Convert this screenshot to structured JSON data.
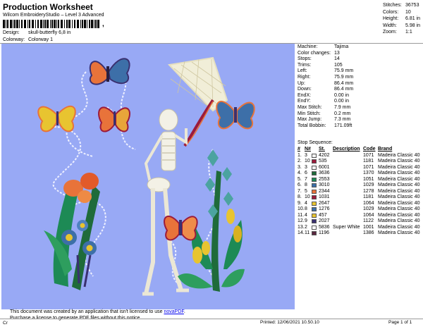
{
  "header": {
    "title": "Production Worksheet",
    "subtitle": "Wilcom EmbroideryStudio – Level 3 Advanced",
    "barcode_suffix": ",",
    "design_label": "Design:",
    "design_value": "skull-butterfly 6,8 in",
    "colorway_label": "Colorway:",
    "colorway_value": "Colorway 1"
  },
  "summary": [
    {
      "label": "Stitches:",
      "value": "36753"
    },
    {
      "label": "Colors:",
      "value": "10"
    },
    {
      "label": "Height:",
      "value": "6.81 in"
    },
    {
      "label": "Width:",
      "value": "5.98 in"
    },
    {
      "label": "Zoom:",
      "value": "1:1"
    }
  ],
  "specs": [
    {
      "label": "Machine:",
      "value": "Tajima"
    },
    {
      "label": "Color changes:",
      "value": "13"
    },
    {
      "label": "Stops:",
      "value": "14"
    },
    {
      "label": "Trims:",
      "value": "105"
    },
    {
      "label": "Left:",
      "value": "75.9 mm"
    },
    {
      "label": "Right:",
      "value": "75.9 mm"
    },
    {
      "label": "Up:",
      "value": "86.4 mm"
    },
    {
      "label": "Down:",
      "value": "86.4 mm"
    },
    {
      "label": "EndX:",
      "value": "0.00 in"
    },
    {
      "label": "EndY:",
      "value": "0.00 in"
    },
    {
      "label": "Max Stitch:",
      "value": "7.9 mm"
    },
    {
      "label": "Min Stitch:",
      "value": "0.2 mm"
    },
    {
      "label": "Max Jump:",
      "value": "7.3 mm"
    },
    {
      "label": "Total Bobbin:",
      "value": "171.09ft"
    }
  ],
  "stop_sequence": {
    "heading": "Stop Sequence:",
    "columns": [
      "#",
      "N#",
      "St.",
      "Description",
      "Code",
      "Brand"
    ],
    "rows": [
      {
        "idx": "1.",
        "n": "3",
        "color": "#f2f2f2",
        "st": "4202",
        "desc": "",
        "code": "1071",
        "brand": "Madeira Classic 40"
      },
      {
        "idx": "2.",
        "n": "10",
        "color": "#9b1b3c",
        "st": "535",
        "desc": "",
        "code": "1181",
        "brand": "Madeira Classic 40"
      },
      {
        "idx": "3.",
        "n": "3",
        "color": "#f2f2f2",
        "st": "6001",
        "desc": "",
        "code": "1071",
        "brand": "Madeira Classic 40"
      },
      {
        "idx": "4.",
        "n": "6",
        "color": "#1f6b3a",
        "st": "3636",
        "desc": "",
        "code": "1370",
        "brand": "Madeira Classic 40"
      },
      {
        "idx": "5.",
        "n": "7",
        "color": "#1d8a55",
        "st": "2553",
        "desc": "",
        "code": "1051",
        "brand": "Madeira Classic 40"
      },
      {
        "idx": "6.",
        "n": "8",
        "color": "#3d6fa8",
        "st": "3010",
        "desc": "",
        "code": "1029",
        "brand": "Madeira Classic 40"
      },
      {
        "idx": "7.",
        "n": "5",
        "color": "#e8733a",
        "st": "2344",
        "desc": "",
        "code": "1278",
        "brand": "Madeira Classic 40"
      },
      {
        "idx": "8.",
        "n": "10",
        "color": "#9b1b3c",
        "st": "1031",
        "desc": "",
        "code": "1181",
        "brand": "Madeira Classic 40"
      },
      {
        "idx": "9.",
        "n": "4",
        "color": "#e8c430",
        "st": "2647",
        "desc": "",
        "code": "1064",
        "brand": "Madeira Classic 40"
      },
      {
        "idx": "10.",
        "n": "8",
        "color": "#3d6fa8",
        "st": "1276",
        "desc": "",
        "code": "1029",
        "brand": "Madeira Classic 40"
      },
      {
        "idx": "11.",
        "n": "4",
        "color": "#e8c430",
        "st": "457",
        "desc": "",
        "code": "1064",
        "brand": "Madeira Classic 40"
      },
      {
        "idx": "12.",
        "n": "9",
        "color": "#3a3070",
        "st": "2027",
        "desc": "",
        "code": "1122",
        "brand": "Madeira Classic 40"
      },
      {
        "idx": "13.",
        "n": "2",
        "color": "#ffffff",
        "st": "5836",
        "desc": "Super White",
        "code": "1001",
        "brand": "Madeira Classic 40"
      },
      {
        "idx": "14.",
        "n": "11",
        "color": "#5a2840",
        "st": "1196",
        "desc": "",
        "code": "1386",
        "brand": "Madeira Classic 40"
      }
    ]
  },
  "notice": {
    "line1_prefix": "This document was created by an application that isn't licensed to use ",
    "link": "novaPDF",
    "line1_suffix": ".",
    "line2": "Purchase a license to generate PDF files without this notice."
  },
  "footer": {
    "left": "Cr",
    "printed": "Printed: 12/06/2021 10.50.10",
    "page": "Page 1 of 1"
  },
  "colors": {
    "background": "#98a9f5",
    "thread_white": "#f2f2f2",
    "red": "#9b1b3c",
    "green_dark": "#1f6b3a",
    "green": "#1d8a55",
    "blue": "#3d6fa8",
    "orange": "#e8733a",
    "yellow": "#e8c430",
    "purple": "#3a3070",
    "wine": "#5a2840"
  }
}
